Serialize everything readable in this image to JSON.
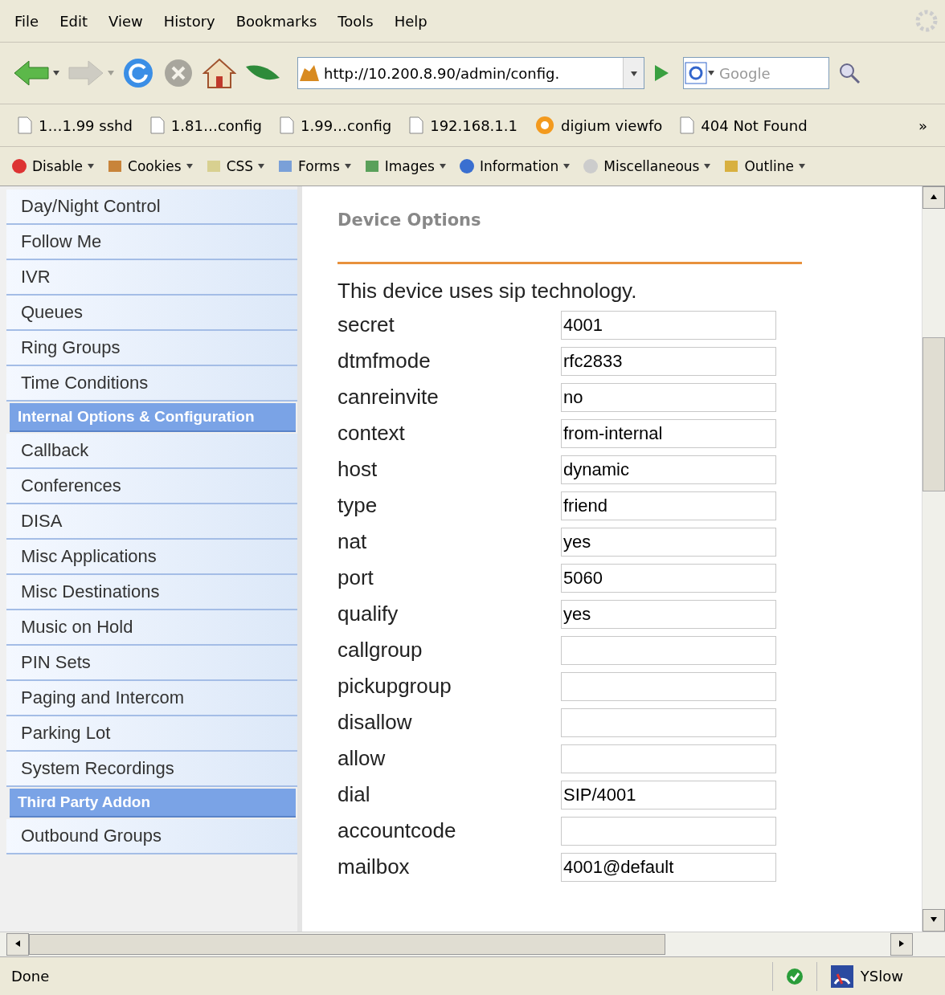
{
  "menu": [
    "File",
    "Edit",
    "View",
    "History",
    "Bookmarks",
    "Tools",
    "Help"
  ],
  "nav_buttons": [
    {
      "kind": "back",
      "disabled": false
    },
    {
      "kind": "forward",
      "disabled": true
    },
    {
      "kind": "reload",
      "disabled": false
    },
    {
      "kind": "stop",
      "disabled": true
    },
    {
      "kind": "home",
      "disabled": false
    },
    {
      "kind": "leaf",
      "disabled": false
    }
  ],
  "address": {
    "value": "http://10.200.8.90/admin/config."
  },
  "search": {
    "placeholder": "Google"
  },
  "bookmarks": [
    {
      "label": "1…1.99 sshd",
      "kind": "page"
    },
    {
      "label": "1.81…config",
      "kind": "page"
    },
    {
      "label": "1.99…config",
      "kind": "page"
    },
    {
      "label": "192.168.1.1",
      "kind": "page"
    },
    {
      "label": "digium viewfo",
      "kind": "feed"
    },
    {
      "label": "404 Not Found",
      "kind": "page"
    }
  ],
  "bookmarks_more": "»",
  "dev_toolbar": [
    {
      "label": "Disable",
      "kind": "disable"
    },
    {
      "label": "Cookies",
      "kind": "cookies"
    },
    {
      "label": "CSS",
      "kind": "css"
    },
    {
      "label": "Forms",
      "kind": "forms"
    },
    {
      "label": "Images",
      "kind": "images"
    },
    {
      "label": "Information",
      "kind": "info"
    },
    {
      "label": "Miscellaneous",
      "kind": "misc"
    },
    {
      "label": "Outline",
      "kind": "outline"
    }
  ],
  "sidebar": {
    "items": [
      {
        "label": "Day/Night Control",
        "kind": "link"
      },
      {
        "label": "Follow Me",
        "kind": "link"
      },
      {
        "label": "IVR",
        "kind": "link"
      },
      {
        "label": "Queues",
        "kind": "link"
      },
      {
        "label": "Ring Groups",
        "kind": "link"
      },
      {
        "label": "Time Conditions",
        "kind": "link"
      },
      {
        "label": "Internal Options & Configuration",
        "kind": "header"
      },
      {
        "label": "Callback",
        "kind": "link"
      },
      {
        "label": "Conferences",
        "kind": "link"
      },
      {
        "label": "DISA",
        "kind": "link"
      },
      {
        "label": "Misc Applications",
        "kind": "link"
      },
      {
        "label": "Misc Destinations",
        "kind": "link"
      },
      {
        "label": "Music on Hold",
        "kind": "link"
      },
      {
        "label": "PIN Sets",
        "kind": "link"
      },
      {
        "label": "Paging and Intercom",
        "kind": "link"
      },
      {
        "label": "Parking Lot",
        "kind": "link"
      },
      {
        "label": "System Recordings",
        "kind": "link"
      },
      {
        "label": "Third Party Addon",
        "kind": "header"
      },
      {
        "label": "Outbound Groups",
        "kind": "link"
      }
    ]
  },
  "content": {
    "title": "Device Options",
    "intro": "This device uses sip technology.",
    "fields": [
      {
        "label": "secret",
        "value": "4001"
      },
      {
        "label": "dtmfmode",
        "value": "rfc2833"
      },
      {
        "label": "canreinvite",
        "value": "no"
      },
      {
        "label": "context",
        "value": "from-internal"
      },
      {
        "label": "host",
        "value": "dynamic"
      },
      {
        "label": "type",
        "value": "friend"
      },
      {
        "label": "nat",
        "value": "yes"
      },
      {
        "label": "port",
        "value": "5060"
      },
      {
        "label": "qualify",
        "value": "yes"
      },
      {
        "label": "callgroup"
      },
      {
        "label": "pickupgroup"
      },
      {
        "label": "disallow"
      },
      {
        "label": "allow"
      },
      {
        "label": "dial",
        "value": "SIP/4001"
      },
      {
        "label": "accountcode"
      },
      {
        "label": "mailbox",
        "value": "4001@default"
      }
    ]
  },
  "status_bar": {
    "text": "Done",
    "addon": "YSlow"
  }
}
